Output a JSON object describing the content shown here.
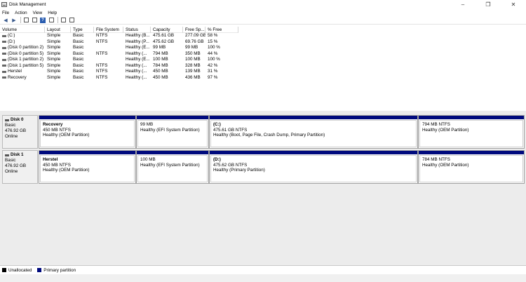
{
  "window": {
    "title": "Disk Management",
    "controls": [
      "–",
      "❐",
      "✕"
    ]
  },
  "menu": [
    "File",
    "Action",
    "View",
    "Help"
  ],
  "volume_list": {
    "columns": [
      "Volume",
      "Layout",
      "Type",
      "File System",
      "Status",
      "Capacity",
      "Free Sp...",
      "% Free"
    ],
    "rows": [
      [
        "(C:)",
        "Simple",
        "Basic",
        "NTFS",
        "Healthy (B...",
        "475.61 GB",
        "277.09 GB",
        "58 %"
      ],
      [
        "(D:)",
        "Simple",
        "Basic",
        "NTFS",
        "Healthy (P...",
        "475.62 GB",
        "69.76 GB",
        "15 %"
      ],
      [
        "(Disk 0 partition 2)",
        "Simple",
        "Basic",
        "",
        "Healthy (E...",
        "99 MB",
        "99 MB",
        "100 %"
      ],
      [
        "(Disk 0 partition 5)",
        "Simple",
        "Basic",
        "NTFS",
        "Healthy (...",
        "794 MB",
        "350 MB",
        "44 %"
      ],
      [
        "(Disk 1 partition 2)",
        "Simple",
        "Basic",
        "",
        "Healthy (E...",
        "100 MB",
        "100 MB",
        "100 %"
      ],
      [
        "(Disk 1 partition 5)",
        "Simple",
        "Basic",
        "NTFS",
        "Healthy (...",
        "784 MB",
        "328 MB",
        "42 %"
      ],
      [
        "Herstel",
        "Simple",
        "Basic",
        "NTFS",
        "Healthy (...",
        "450 MB",
        "139 MB",
        "31 %"
      ],
      [
        "Recovery",
        "Simple",
        "Basic",
        "NTFS",
        "Healthy (...",
        "450 MB",
        "436 MB",
        "97 %"
      ]
    ]
  },
  "disks": [
    {
      "name": "Disk 0",
      "type": "Basic",
      "size": "476.92 GB",
      "state": "Online",
      "partitions": [
        {
          "name": "Recovery",
          "size": "450 MB NTFS",
          "status": "Healthy (OEM Partition)"
        },
        {
          "name": "",
          "size": "99 MB",
          "status": "Healthy (EFI System Partition)"
        },
        {
          "name": "(C:)",
          "size": "475.61 GB NTFS",
          "status": "Healthy (Boot, Page File, Crash Dump, Primary Partition)"
        },
        {
          "name": "",
          "size": "794 MB NTFS",
          "status": "Healthy (OEM Partition)"
        }
      ]
    },
    {
      "name": "Disk 1",
      "type": "Basic",
      "size": "476.92 GB",
      "state": "Online",
      "partitions": [
        {
          "name": "Herstel",
          "size": "450 MB NTFS",
          "status": "Healthy (OEM Partition)"
        },
        {
          "name": "",
          "size": "100 MB",
          "status": "Healthy (EFI System Partition)"
        },
        {
          "name": "(D:)",
          "size": "475.62 GB NTFS",
          "status": "Healthy (Primary Partition)"
        },
        {
          "name": "",
          "size": "784 MB NTFS",
          "status": "Healthy (OEM Partition)"
        }
      ]
    }
  ],
  "legend": [
    {
      "label": "Unallocated",
      "color": "#000000"
    },
    {
      "label": "Primary partition",
      "color": "#000a7d"
    }
  ]
}
